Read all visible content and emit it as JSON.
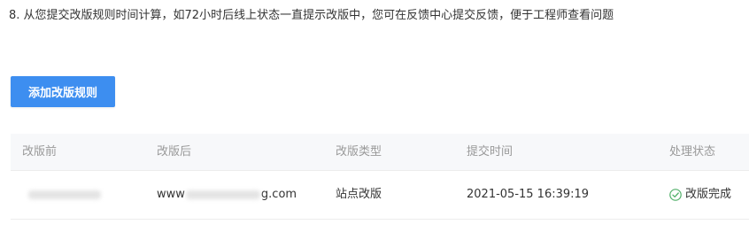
{
  "notice": "8. 从您提交改版规则时间计算，如72小时后线上状态一直提示改版中，您可在反馈中心提交反馈，便于工程师查看问题",
  "add_button_label": "添加改版规则",
  "table": {
    "headers": [
      "改版前",
      "改版后",
      "改版类型",
      "提交时间",
      "处理状态"
    ],
    "rows": [
      {
        "after_prefix": "www",
        "after_suffix": "g.com",
        "type": "站点改版",
        "submit_time": "2021-05-15 16:39:19",
        "status": "改版完成"
      }
    ]
  },
  "colors": {
    "accent": "#3d8ef0",
    "success": "#52b06a",
    "header_bg": "#f7f8fa"
  },
  "icons": {
    "status": "check-circle-icon"
  }
}
